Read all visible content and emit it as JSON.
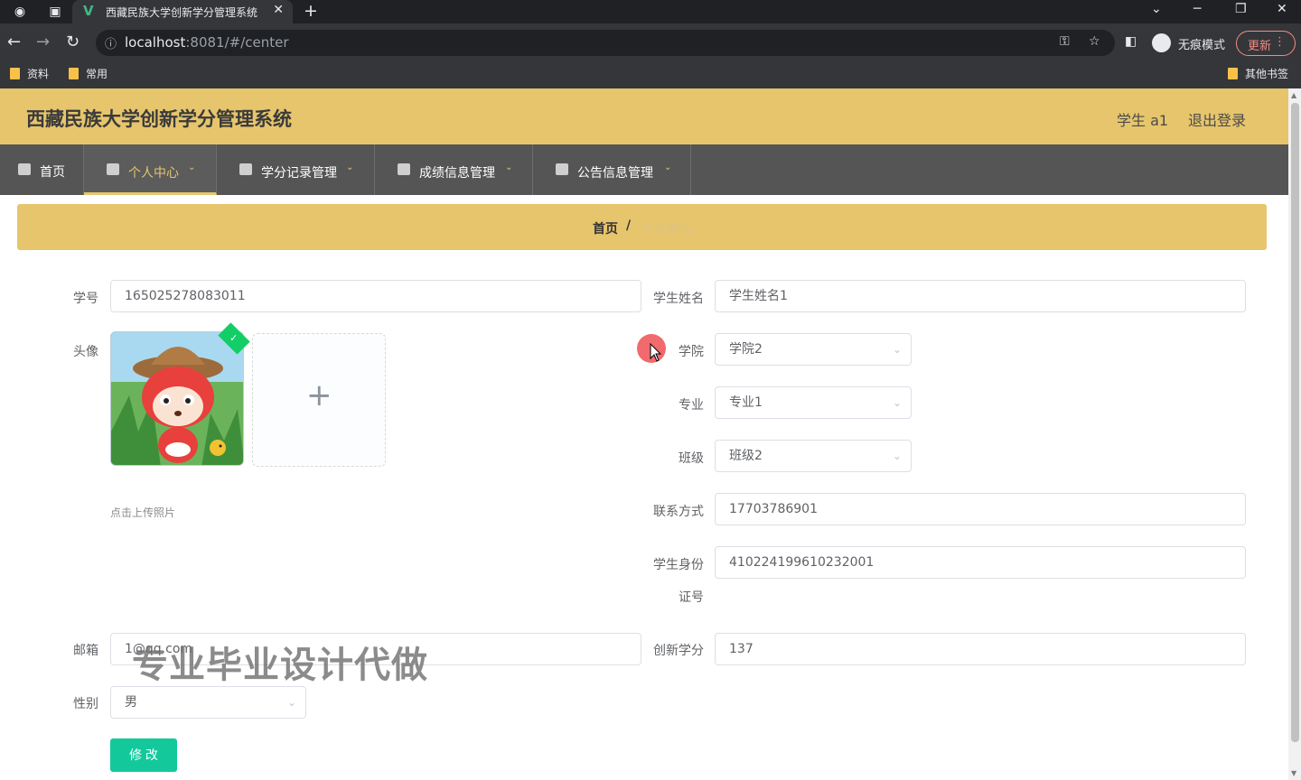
{
  "browser": {
    "tab_title": "西藏民族大学创新学分管理系统",
    "url_host": "localhost",
    "url_path": ":8081/#/center",
    "incognito_label": "无痕模式",
    "update_label": "更新",
    "bookmarks": [
      "资料",
      "常用"
    ],
    "other_bookmarks": "其他书签"
  },
  "header": {
    "title": "西藏民族大学创新学分管理系统",
    "user": "学生 a1",
    "logout": "退出登录"
  },
  "nav": {
    "items": [
      {
        "label": "首页"
      },
      {
        "label": "个人中心"
      },
      {
        "label": "学分记录管理"
      },
      {
        "label": "成绩信息管理"
      },
      {
        "label": "公告信息管理"
      }
    ]
  },
  "breadcrumb": {
    "home": "首页",
    "separator": "/",
    "current": "个人中心"
  },
  "form": {
    "student_id": {
      "label": "学号",
      "value": "165025278083011"
    },
    "student_name": {
      "label": "学生姓名",
      "value": "学生姓名1"
    },
    "avatar": {
      "label": "头像",
      "hint": "点击上传照片"
    },
    "college": {
      "label": "学院",
      "value": "学院2"
    },
    "major": {
      "label": "专业",
      "value": "专业1"
    },
    "class": {
      "label": "班级",
      "value": "班级2"
    },
    "phone": {
      "label": "联系方式",
      "value": "17703786901"
    },
    "id_card": {
      "label_line1": "学生身份",
      "label_line2": "证号",
      "value": "410224199610232001"
    },
    "email": {
      "label": "邮箱",
      "value": "1@qq.com"
    },
    "credits": {
      "label": "创新学分",
      "value": "137"
    },
    "gender": {
      "label": "性别",
      "value": "男"
    },
    "submit_label": "修 改"
  },
  "overlay": {
    "watermark": "专业毕业设计代做"
  },
  "colors": {
    "header_bg": "#e6c56c",
    "nav_bg": "#555555",
    "submit_bg": "#13c99c",
    "chrome_bg": "#35363a"
  }
}
